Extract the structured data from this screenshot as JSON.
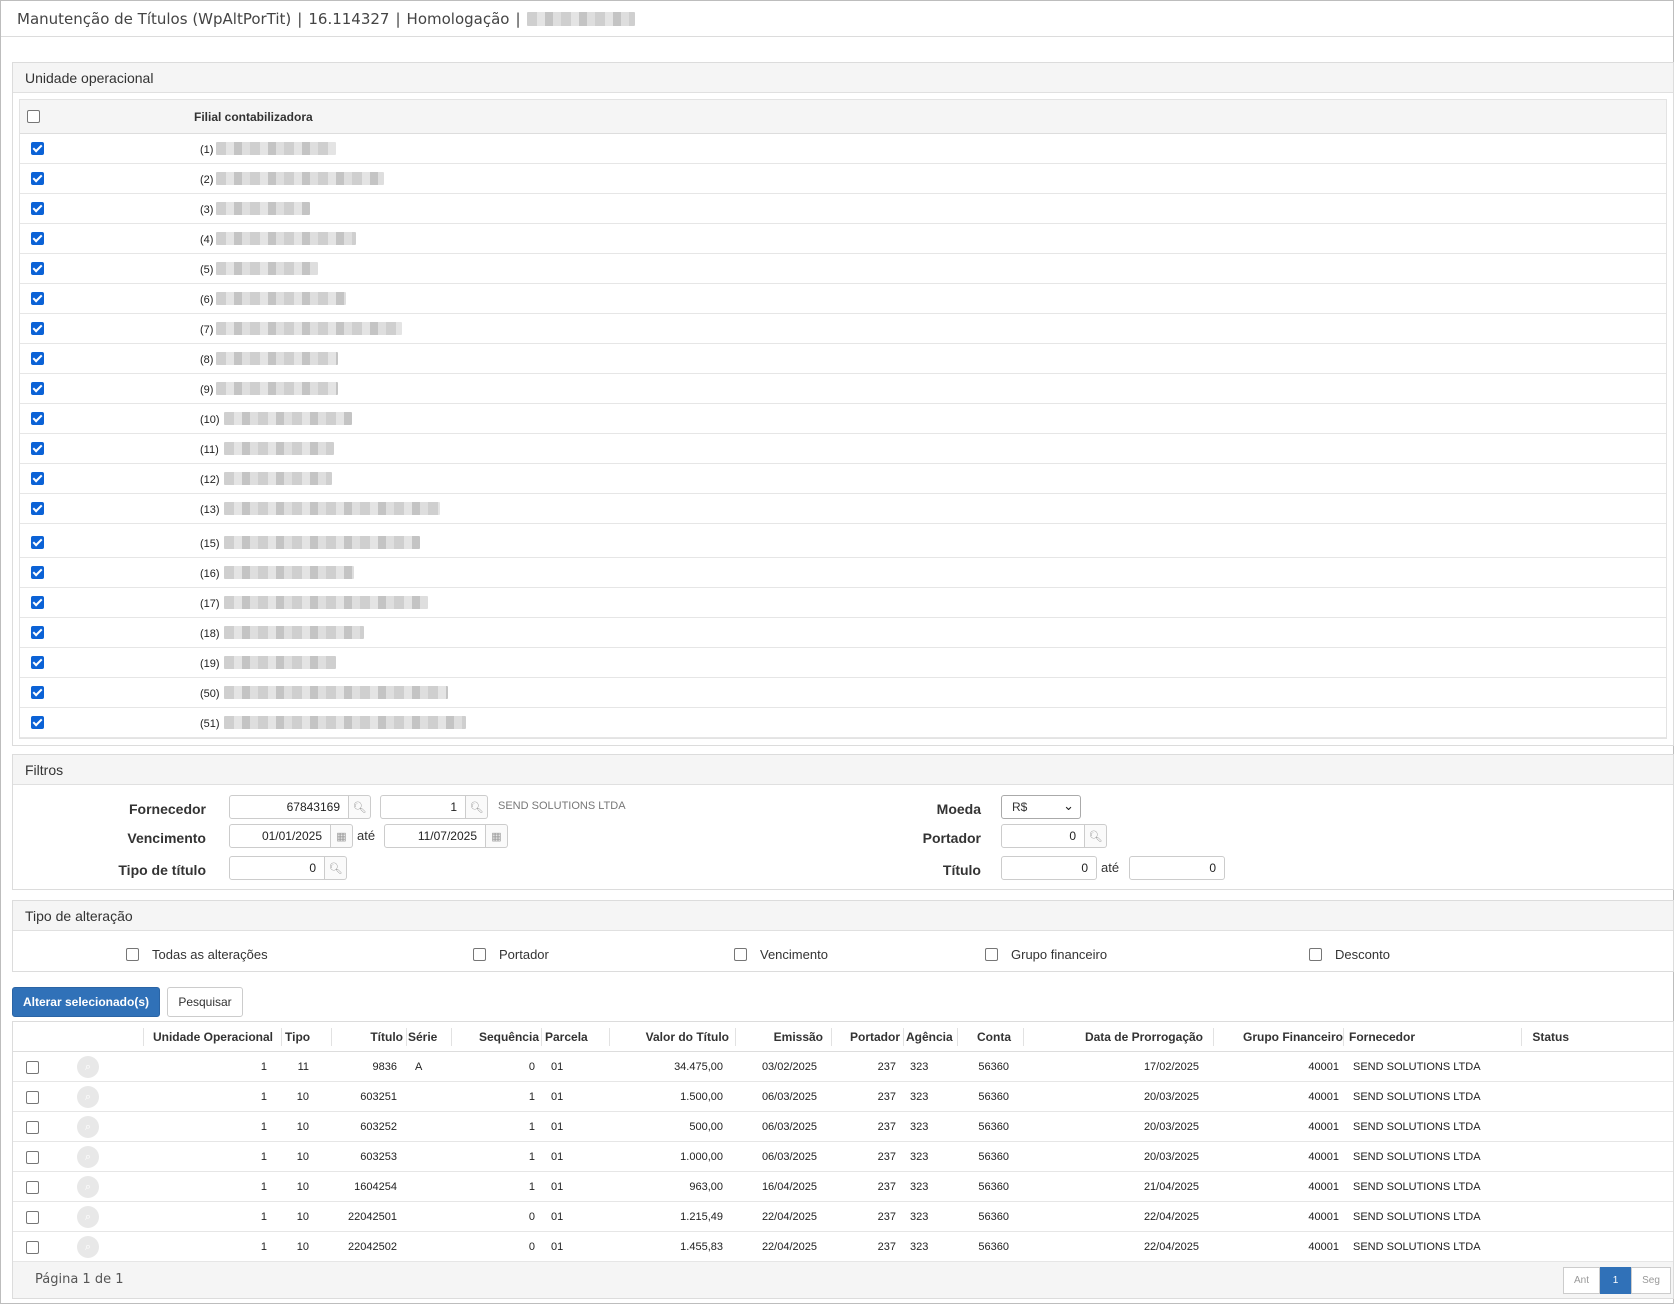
{
  "window": {
    "title": "Manutenção de Títulos (WpAltPorTit)",
    "version": "16.114327",
    "environment": "Homologação",
    "separator": "|"
  },
  "unidade": {
    "header": "Unidade operacional",
    "column": "Filial contabilizadora",
    "rows": [
      {
        "code": "(1)"
      },
      {
        "code": "(2)"
      },
      {
        "code": "(3)"
      },
      {
        "code": "(4)"
      },
      {
        "code": "(5)"
      },
      {
        "code": "(6)"
      },
      {
        "code": "(7)"
      },
      {
        "code": "(8)"
      },
      {
        "code": "(9)"
      },
      {
        "code": "(10)"
      },
      {
        "code": "(11)"
      },
      {
        "code": "(12)"
      },
      {
        "code": "(13)"
      },
      {
        "code": "(15)"
      },
      {
        "code": "(16)"
      },
      {
        "code": "(17)"
      },
      {
        "code": "(18)"
      },
      {
        "code": "(19)"
      },
      {
        "code": "(50)"
      },
      {
        "code": "(51)"
      }
    ]
  },
  "filtros": {
    "header": "Filtros",
    "fornecedor_label": "Fornecedor",
    "fornecedor_code": "67843169",
    "fornecedor_seq": "1",
    "fornecedor_name": "SEND SOLUTIONS LTDA",
    "vencimento_label": "Vencimento",
    "vencimento_from": "01/01/2025",
    "vencimento_to": "11/07/2025",
    "ate": "até",
    "tipo_label": "Tipo de título",
    "tipo_value": "0",
    "moeda_label": "Moeda",
    "moeda_value": "R$",
    "portador_label": "Portador",
    "portador_value": "0",
    "titulo_label": "Título",
    "titulo_from": "0",
    "titulo_to": "0"
  },
  "alteracao": {
    "header": "Tipo de alteração",
    "options": [
      "Todas as alterações",
      "Portador",
      "Vencimento",
      "Grupo financeiro",
      "Desconto"
    ]
  },
  "actions": {
    "alterar": "Alterar selecionado(s)",
    "pesquisar": "Pesquisar"
  },
  "grid": {
    "columns": [
      "Unidade Operacional",
      "Tipo",
      "Título",
      "Série",
      "Sequência",
      "Parcela",
      "Valor do Título",
      "Emissão",
      "Portador",
      "Agência",
      "Conta",
      "Data de Prorrogação",
      "Grupo Financeiro",
      "Fornecedor",
      "Status"
    ],
    "rows": [
      [
        "1",
        "11",
        "9836",
        "A",
        "0",
        "01",
        "34.475,00",
        "03/02/2025",
        "237",
        "323",
        "56360",
        "17/02/2025",
        "40001",
        "SEND SOLUTIONS LTDA",
        ""
      ],
      [
        "1",
        "10",
        "603251",
        "",
        "1",
        "01",
        "1.500,00",
        "06/03/2025",
        "237",
        "323",
        "56360",
        "20/03/2025",
        "40001",
        "SEND SOLUTIONS LTDA",
        ""
      ],
      [
        "1",
        "10",
        "603252",
        "",
        "1",
        "01",
        "500,00",
        "06/03/2025",
        "237",
        "323",
        "56360",
        "20/03/2025",
        "40001",
        "SEND SOLUTIONS LTDA",
        ""
      ],
      [
        "1",
        "10",
        "603253",
        "",
        "1",
        "01",
        "1.000,00",
        "06/03/2025",
        "237",
        "323",
        "56360",
        "20/03/2025",
        "40001",
        "SEND SOLUTIONS LTDA",
        ""
      ],
      [
        "1",
        "10",
        "1604254",
        "",
        "1",
        "01",
        "963,00",
        "16/04/2025",
        "237",
        "323",
        "56360",
        "21/04/2025",
        "40001",
        "SEND SOLUTIONS LTDA",
        ""
      ],
      [
        "1",
        "10",
        "22042501",
        "",
        "0",
        "01",
        "1.215,49",
        "22/04/2025",
        "237",
        "323",
        "56360",
        "22/04/2025",
        "40001",
        "SEND SOLUTIONS LTDA",
        ""
      ],
      [
        "1",
        "10",
        "22042502",
        "",
        "0",
        "01",
        "1.455,83",
        "22/04/2025",
        "237",
        "323",
        "56360",
        "22/04/2025",
        "40001",
        "SEND SOLUTIONS LTDA",
        ""
      ]
    ],
    "footer": "Página 1 de 1",
    "pager": {
      "prev": "Ant",
      "current": "1",
      "next": "Seg"
    }
  }
}
